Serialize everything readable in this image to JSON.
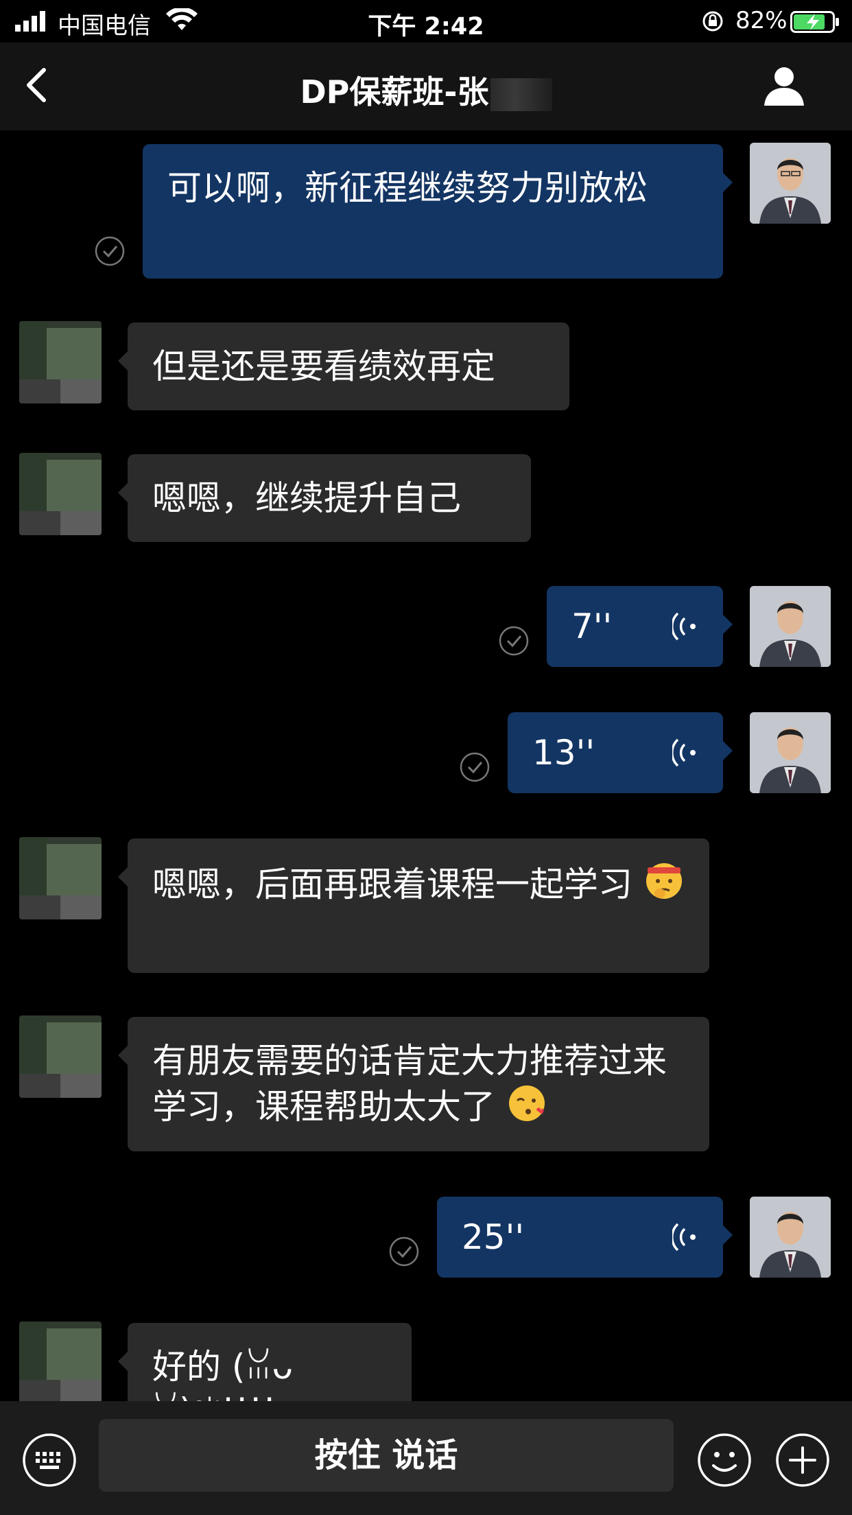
{
  "status_bar": {
    "carrier": "中国电信",
    "time": "下午 2:42",
    "battery_percent": "82%",
    "battery_level": 0.82
  },
  "nav": {
    "title": "DP保薪班-张",
    "back_icon": "chevron-left-icon",
    "profile_icon": "person-icon"
  },
  "messages": [
    {
      "sender": "me",
      "type": "text",
      "text": "可以啊，新征程继续努力别放松",
      "read": true
    },
    {
      "sender": "other",
      "type": "text",
      "text": "但是还是要看绩效再定"
    },
    {
      "sender": "other",
      "type": "text",
      "text": "嗯嗯，继续提升自己"
    },
    {
      "sender": "me",
      "type": "voice",
      "duration": "7''",
      "read": true
    },
    {
      "sender": "me",
      "type": "voice",
      "duration": "13''",
      "read": true
    },
    {
      "sender": "other",
      "type": "text",
      "text": "嗯嗯，后面再跟着课程一起学习",
      "emoji": "determined-face-emoji"
    },
    {
      "sender": "other",
      "type": "text",
      "text": "有朋友需要的话肯定大力推荐过来学习，课程帮助太大了",
      "emoji": "kissing-face-emoji"
    },
    {
      "sender": "me",
      "type": "voice",
      "duration": "25''",
      "read": true
    },
    {
      "sender": "other",
      "type": "text",
      "text": "好的 (ꈍᴗꈍ)ᵒᵏ!!!!"
    }
  ],
  "bottom_bar": {
    "hold_to_talk": "按住 说话",
    "keyboard_icon": "keyboard-icon",
    "emoji_icon": "smiley-icon",
    "plus_icon": "plus-icon"
  },
  "colors": {
    "my_bubble": "#133563",
    "other_bubble": "#2b2b2b",
    "background": "#000000",
    "battery_green": "#4cd964"
  }
}
